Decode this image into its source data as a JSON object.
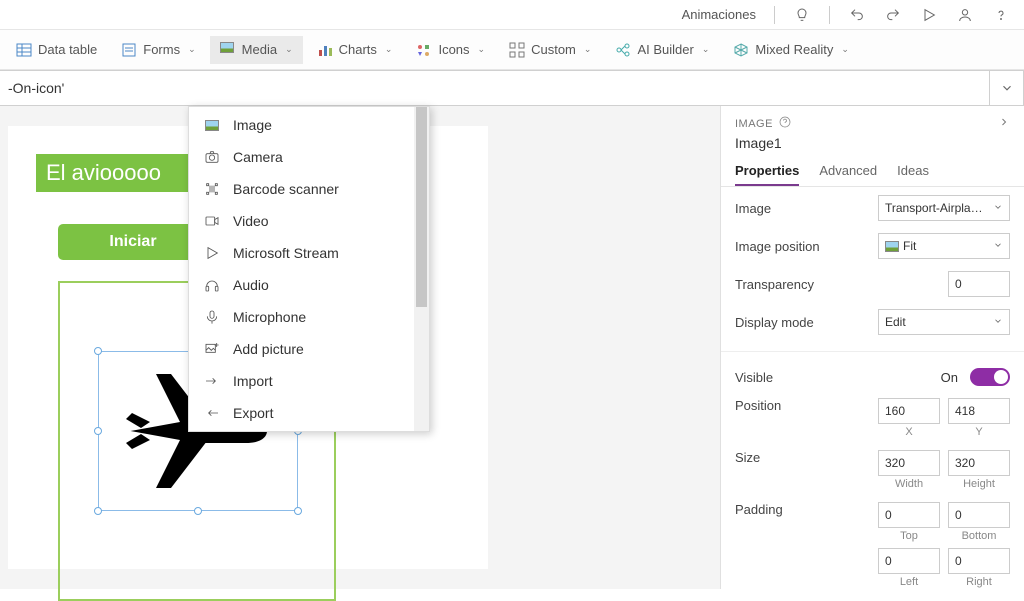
{
  "titlebar": {
    "animations": "Animaciones"
  },
  "ribbon": {
    "data_table": "Data table",
    "forms": "Forms",
    "media": "Media",
    "charts": "Charts",
    "icons": "Icons",
    "custom": "Custom",
    "ai_builder": "AI Builder",
    "mixed_reality": "Mixed Reality"
  },
  "formula": {
    "value": "-On-icon'"
  },
  "media_menu": {
    "items": [
      "Image",
      "Camera",
      "Barcode scanner",
      "Video",
      "Microsoft Stream",
      "Audio",
      "Microphone",
      "Add picture",
      "Import",
      "Export"
    ]
  },
  "canvas": {
    "screen_title": "El aviooooo",
    "start_button": "Iniciar"
  },
  "panel": {
    "crumb": "IMAGE",
    "control_name": "Image1",
    "tabs": {
      "properties": "Properties",
      "advanced": "Advanced",
      "ideas": "Ideas"
    },
    "props": {
      "image_label": "Image",
      "image_value": "Transport-Airplane-...",
      "image_position_label": "Image position",
      "image_position_value": "Fit",
      "transparency_label": "Transparency",
      "transparency_value": "0",
      "display_mode_label": "Display mode",
      "display_mode_value": "Edit",
      "visible_label": "Visible",
      "visible_value": "On",
      "position_label": "Position",
      "position_x": "160",
      "position_y": "418",
      "x_label": "X",
      "y_label": "Y",
      "size_label": "Size",
      "size_w": "320",
      "size_h": "320",
      "w_label": "Width",
      "h_label": "Height",
      "padding_label": "Padding",
      "pad_top": "0",
      "pad_bottom": "0",
      "top_label": "Top",
      "bottom_label": "Bottom",
      "pad_left": "0",
      "pad_right": "0",
      "left_label": "Left",
      "right_label": "Right"
    }
  }
}
